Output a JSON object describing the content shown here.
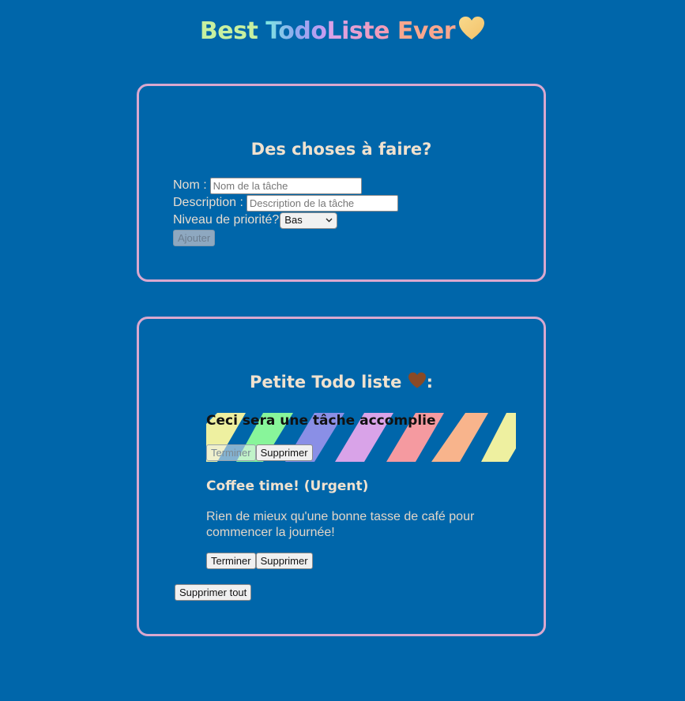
{
  "header": {
    "title_best": "Best",
    "title_todo": "Todo",
    "title_liste": "Liste",
    "title_ever": "Ever",
    "heart_icon": "yellow-heart-icon"
  },
  "form_card": {
    "heading": "Des choses à faire?",
    "name_label": "Nom :",
    "name_placeholder": "Nom de la tâche",
    "name_value": "",
    "description_label": "Description :",
    "description_placeholder": "Description de la tâche",
    "description_value": "",
    "priority_label": "Niveau de priorité?",
    "priority_selected": "Bas",
    "add_button": "Ajouter"
  },
  "list_card": {
    "heading_text": "Petite Todo liste",
    "heading_suffix": ":",
    "heading_icon": "brown-heart-icon",
    "tasks": [
      {
        "title": "Ceci sera une tâche accomplie",
        "complete_label": "Terminer",
        "delete_label": "Supprimer",
        "status": "done"
      },
      {
        "title": "Coffee time! (Urgent)",
        "description": "Rien de mieux qu'une bonne tasse de café pour commencer la journée!",
        "complete_label": "Terminer",
        "delete_label": "Supprimer",
        "status": "pending"
      }
    ],
    "clear_all_button": "Supprimer tout"
  },
  "colors": {
    "background": "#0066aa",
    "card_border": "#d9a8cf",
    "heading_text": "#f0e2cf",
    "stripe_colors": [
      "#eef0a0",
      "#88f59a",
      "#8a8fe6",
      "#d9a3e8",
      "#f59aa0",
      "#f8b48c",
      "#eef0a0"
    ]
  }
}
